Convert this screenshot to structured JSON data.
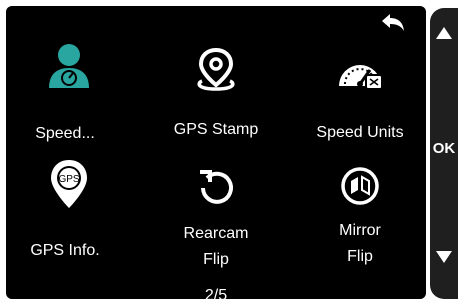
{
  "menu": {
    "items": [
      {
        "label": "Speed...",
        "icon": "speedometer-person-icon"
      },
      {
        "label": "GPS Stamp",
        "icon": "location-pin-icon"
      },
      {
        "label": "Speed Units",
        "icon": "speedometer-icon"
      },
      {
        "label": "GPS Info.",
        "icon": "gps-pin-icon",
        "icon_text": "GPS"
      },
      {
        "label_line1": "Rearcam",
        "label_line2": "Flip",
        "icon": "rotate-icon"
      },
      {
        "label_line1": "Mirror",
        "label_line2": "Flip",
        "icon": "mirror-flip-icon"
      }
    ],
    "page_indicator": "2/5"
  },
  "sidebar": {
    "ok_label": "OK"
  },
  "colors": {
    "screen_bg": "#000000",
    "text": "#ffffff",
    "accent_teal": "#2aa6a0",
    "sidebar_bg": "#1f1f1f"
  }
}
